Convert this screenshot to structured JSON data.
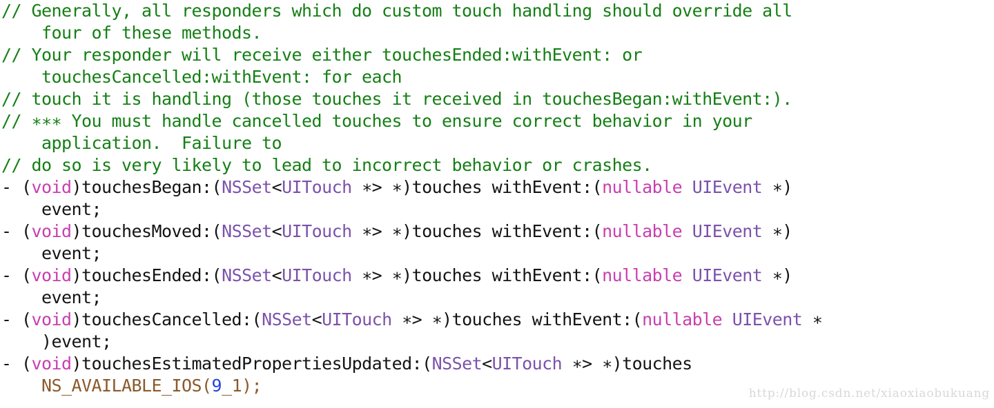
{
  "document": {
    "language": "objective-c",
    "background_color": "#ffffff",
    "colors": {
      "comment": "#157f15",
      "plain": "#141414",
      "keyword": "#c83fb0",
      "type": "#7b52ab",
      "macro": "#8a5a2b",
      "number": "#2244dd",
      "watermark": "#d8d8d8"
    }
  },
  "lines": [
    {
      "index": 0,
      "text": "// Generally, all responders which do custom touch handling should override all",
      "tokens": [
        {
          "t": "// Generally, all responders which do custom touch handling should override all",
          "c": "comment"
        }
      ]
    },
    {
      "index": 1,
      "text": "    four of these methods.",
      "tokens": [
        {
          "t": "    four of these methods.",
          "c": "comment"
        }
      ]
    },
    {
      "index": 2,
      "text": "// Your responder will receive either touchesEnded:withEvent: or",
      "tokens": [
        {
          "t": "// Your responder will receive either touchesEnded:withEvent: or",
          "c": "comment"
        }
      ]
    },
    {
      "index": 3,
      "text": "    touchesCancelled:withEvent: for each",
      "tokens": [
        {
          "t": "    touchesCancelled:withEvent: for each",
          "c": "comment"
        }
      ]
    },
    {
      "index": 4,
      "text": "// touch it is handling (those touches it received in touchesBegan:withEvent:).",
      "tokens": [
        {
          "t": "// touch it is handling (those touches it received in touchesBegan:withEvent:).",
          "c": "comment"
        }
      ]
    },
    {
      "index": 5,
      "text": "// ∗∗∗ You must handle cancelled touches to ensure correct behavior in your",
      "tokens": [
        {
          "t": "// ∗∗∗ You must handle cancelled touches to ensure correct behavior in your",
          "c": "comment"
        }
      ]
    },
    {
      "index": 6,
      "text": "    application.  Failure to",
      "tokens": [
        {
          "t": "    application.  Failure to",
          "c": "comment"
        }
      ]
    },
    {
      "index": 7,
      "text": "// do so is very likely to lead to incorrect behavior or crashes.",
      "tokens": [
        {
          "t": "// do so is very likely to lead to incorrect behavior or crashes.",
          "c": "comment"
        }
      ]
    },
    {
      "index": 8,
      "text": "- (void)touchesBegan:(NSSet<UITouch ∗> ∗)touches withEvent:(nullable UIEvent ∗)",
      "tokens": [
        {
          "t": "- (",
          "c": "plain"
        },
        {
          "t": "void",
          "c": "keyword"
        },
        {
          "t": ")touchesBegan:(",
          "c": "plain"
        },
        {
          "t": "NSSet",
          "c": "type"
        },
        {
          "t": "<",
          "c": "plain"
        },
        {
          "t": "UITouch",
          "c": "type"
        },
        {
          "t": " ∗> ∗)touches withEvent:(",
          "c": "plain"
        },
        {
          "t": "nullable",
          "c": "keyword"
        },
        {
          "t": " ",
          "c": "plain"
        },
        {
          "t": "UIEvent",
          "c": "type"
        },
        {
          "t": " ∗)",
          "c": "plain"
        }
      ]
    },
    {
      "index": 9,
      "text": "    event;",
      "tokens": [
        {
          "t": "    event;",
          "c": "plain"
        }
      ]
    },
    {
      "index": 10,
      "text": "- (void)touchesMoved:(NSSet<UITouch ∗> ∗)touches withEvent:(nullable UIEvent ∗)",
      "tokens": [
        {
          "t": "- (",
          "c": "plain"
        },
        {
          "t": "void",
          "c": "keyword"
        },
        {
          "t": ")touchesMoved:(",
          "c": "plain"
        },
        {
          "t": "NSSet",
          "c": "type"
        },
        {
          "t": "<",
          "c": "plain"
        },
        {
          "t": "UITouch",
          "c": "type"
        },
        {
          "t": " ∗> ∗)touches withEvent:(",
          "c": "plain"
        },
        {
          "t": "nullable",
          "c": "keyword"
        },
        {
          "t": " ",
          "c": "plain"
        },
        {
          "t": "UIEvent",
          "c": "type"
        },
        {
          "t": " ∗)",
          "c": "plain"
        }
      ]
    },
    {
      "index": 11,
      "text": "    event;",
      "tokens": [
        {
          "t": "    event;",
          "c": "plain"
        }
      ]
    },
    {
      "index": 12,
      "text": "- (void)touchesEnded:(NSSet<UITouch ∗> ∗)touches withEvent:(nullable UIEvent ∗)",
      "tokens": [
        {
          "t": "- (",
          "c": "plain"
        },
        {
          "t": "void",
          "c": "keyword"
        },
        {
          "t": ")touchesEnded:(",
          "c": "plain"
        },
        {
          "t": "NSSet",
          "c": "type"
        },
        {
          "t": "<",
          "c": "plain"
        },
        {
          "t": "UITouch",
          "c": "type"
        },
        {
          "t": " ∗> ∗)touches withEvent:(",
          "c": "plain"
        },
        {
          "t": "nullable",
          "c": "keyword"
        },
        {
          "t": " ",
          "c": "plain"
        },
        {
          "t": "UIEvent",
          "c": "type"
        },
        {
          "t": " ∗)",
          "c": "plain"
        }
      ]
    },
    {
      "index": 13,
      "text": "    event;",
      "tokens": [
        {
          "t": "    event;",
          "c": "plain"
        }
      ]
    },
    {
      "index": 14,
      "text": "- (void)touchesCancelled:(NSSet<UITouch ∗> ∗)touches withEvent:(nullable UIEvent ∗",
      "tokens": [
        {
          "t": "- (",
          "c": "plain"
        },
        {
          "t": "void",
          "c": "keyword"
        },
        {
          "t": ")touchesCancelled:(",
          "c": "plain"
        },
        {
          "t": "NSSet",
          "c": "type"
        },
        {
          "t": "<",
          "c": "plain"
        },
        {
          "t": "UITouch",
          "c": "type"
        },
        {
          "t": " ∗> ∗)touches withEvent:(",
          "c": "plain"
        },
        {
          "t": "nullable",
          "c": "keyword"
        },
        {
          "t": " ",
          "c": "plain"
        },
        {
          "t": "UIEvent",
          "c": "type"
        },
        {
          "t": " ∗",
          "c": "plain"
        }
      ]
    },
    {
      "index": 15,
      "text": "    )event;",
      "tokens": [
        {
          "t": "    )event;",
          "c": "plain"
        }
      ]
    },
    {
      "index": 16,
      "text": "- (void)touchesEstimatedPropertiesUpdated:(NSSet<UITouch ∗> ∗)touches",
      "tokens": [
        {
          "t": "- (",
          "c": "plain"
        },
        {
          "t": "void",
          "c": "keyword"
        },
        {
          "t": ")touchesEstimatedPropertiesUpdated:(",
          "c": "plain"
        },
        {
          "t": "NSSet",
          "c": "type"
        },
        {
          "t": "<",
          "c": "plain"
        },
        {
          "t": "UITouch",
          "c": "type"
        },
        {
          "t": " ∗> ∗)touches",
          "c": "plain"
        }
      ]
    },
    {
      "index": 17,
      "text": "    NS_AVAILABLE_IOS(9_1);",
      "tokens": [
        {
          "t": "    ",
          "c": "plain"
        },
        {
          "t": "NS_AVAILABLE_IOS(",
          "c": "macro"
        },
        {
          "t": "9",
          "c": "number"
        },
        {
          "t": "_1);",
          "c": "macro"
        }
      ]
    }
  ],
  "watermark": {
    "text": "http://blog.csdn.net/xiaoxiaobukuang"
  }
}
